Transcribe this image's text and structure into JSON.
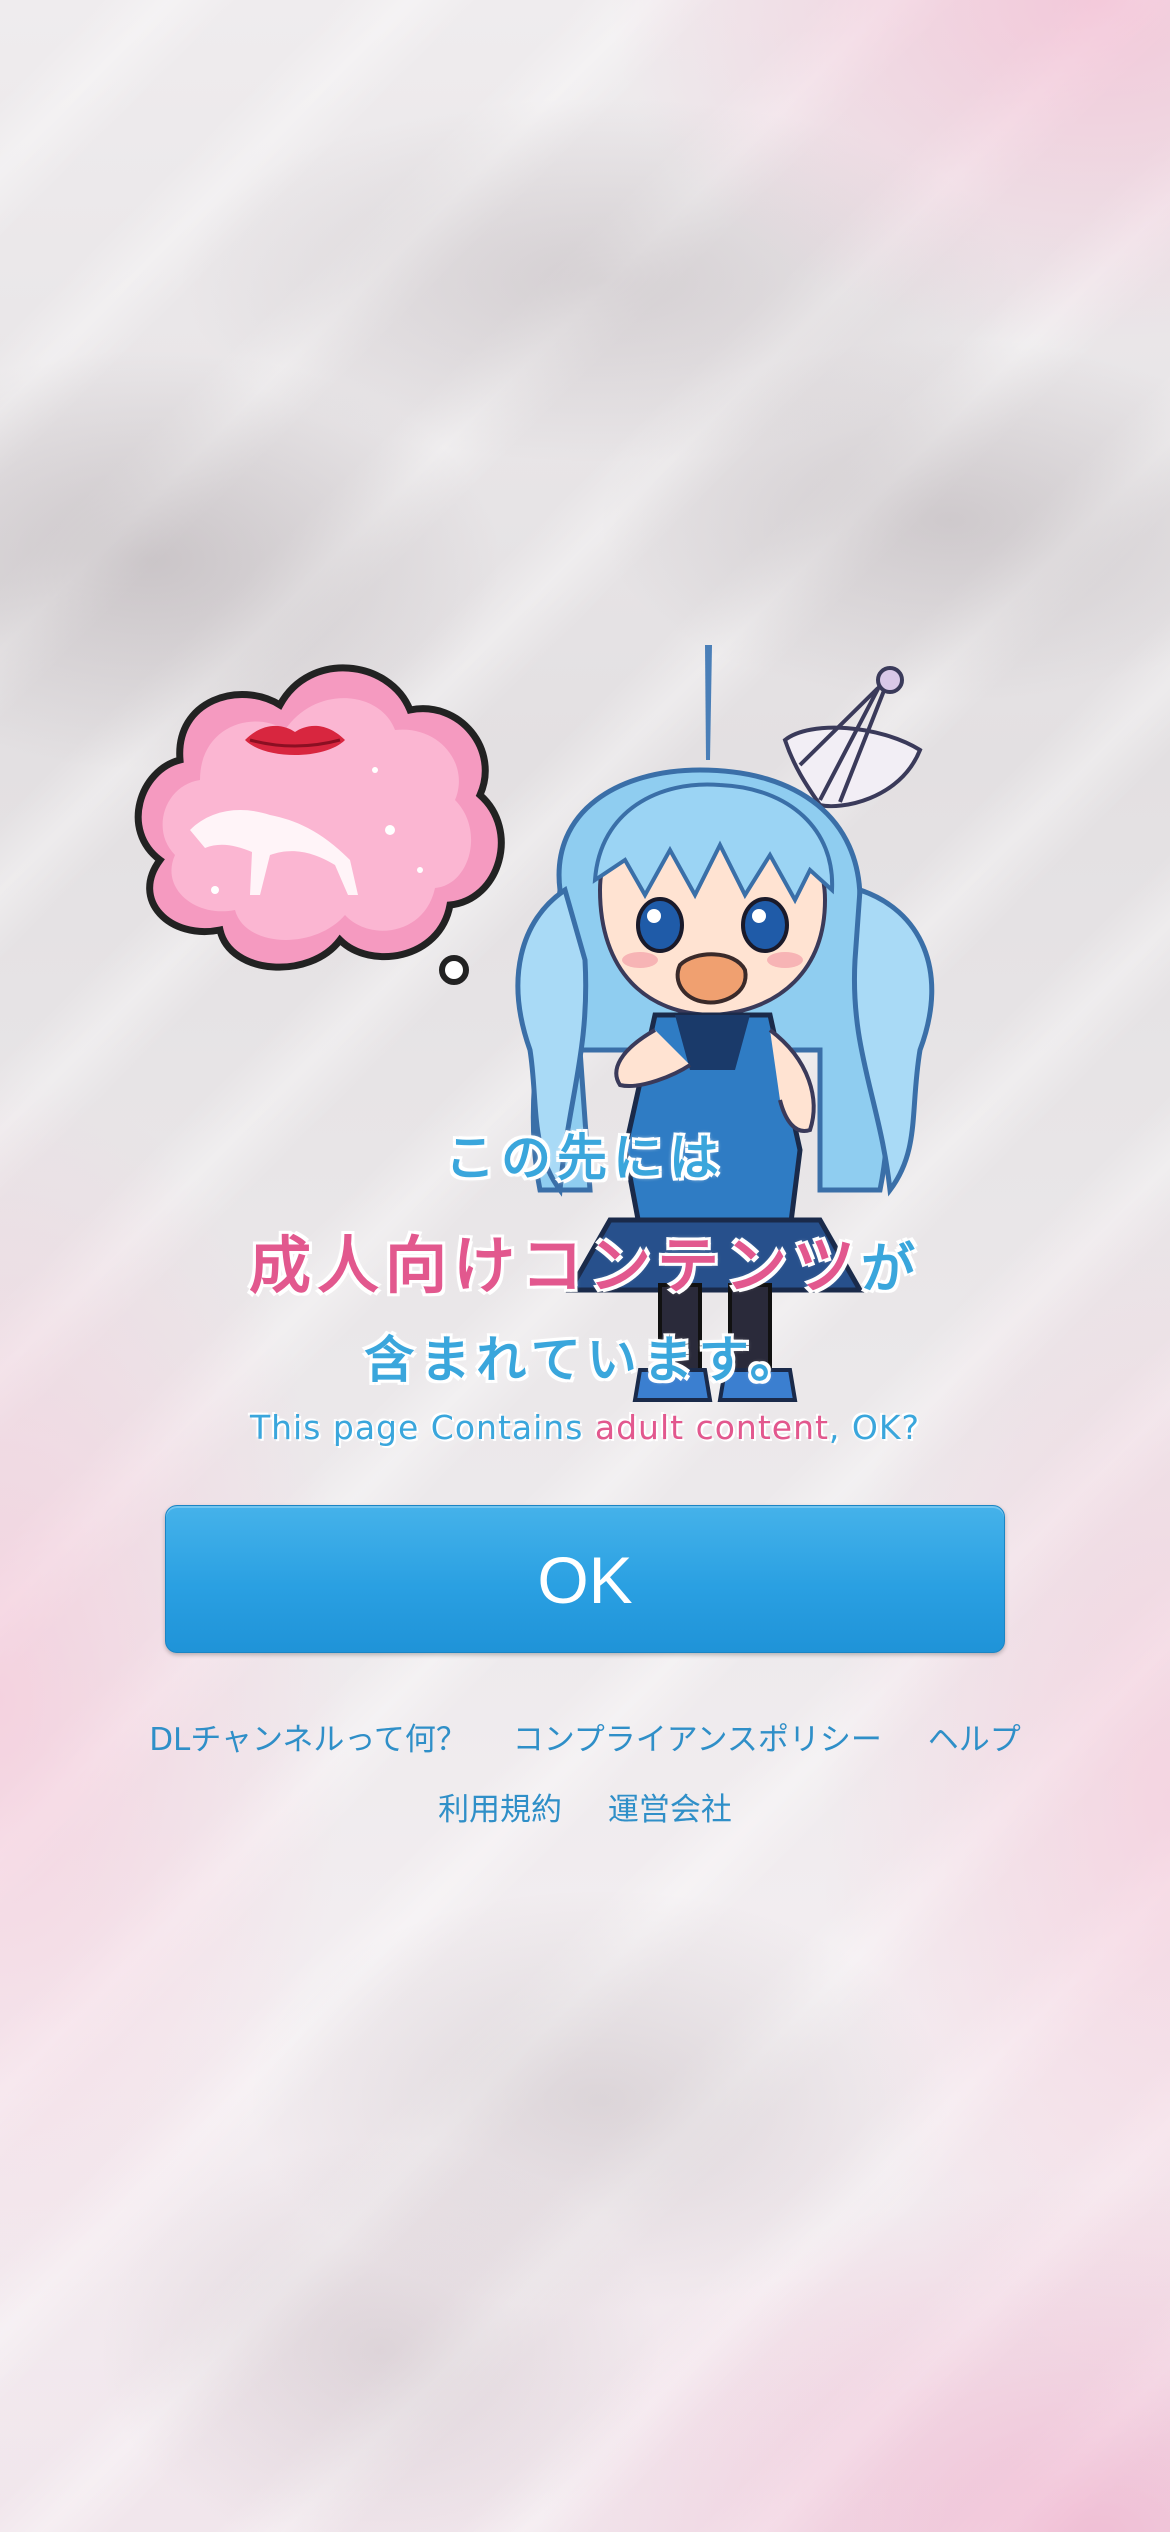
{
  "headline": {
    "line1": "この先には",
    "line2_main": "成人向けコンテンツ",
    "line2_suffix": "が",
    "line3": "含まれています。"
  },
  "subtitle": {
    "part1": "This page Contains ",
    "part2": "adult content",
    "part3": ", OK?"
  },
  "ok_button": {
    "label": "OK"
  },
  "footer": {
    "row1": [
      "DLチャンネルって何？",
      "コンプライアンスポリシー",
      "ヘルプ"
    ],
    "row2": [
      "利用規約",
      "運営会社"
    ]
  },
  "colors": {
    "accent_blue": "#3aa6dc",
    "accent_pink": "#e2588e",
    "button_blue": "#2aa0e2",
    "link_blue": "#2f8fc8"
  }
}
